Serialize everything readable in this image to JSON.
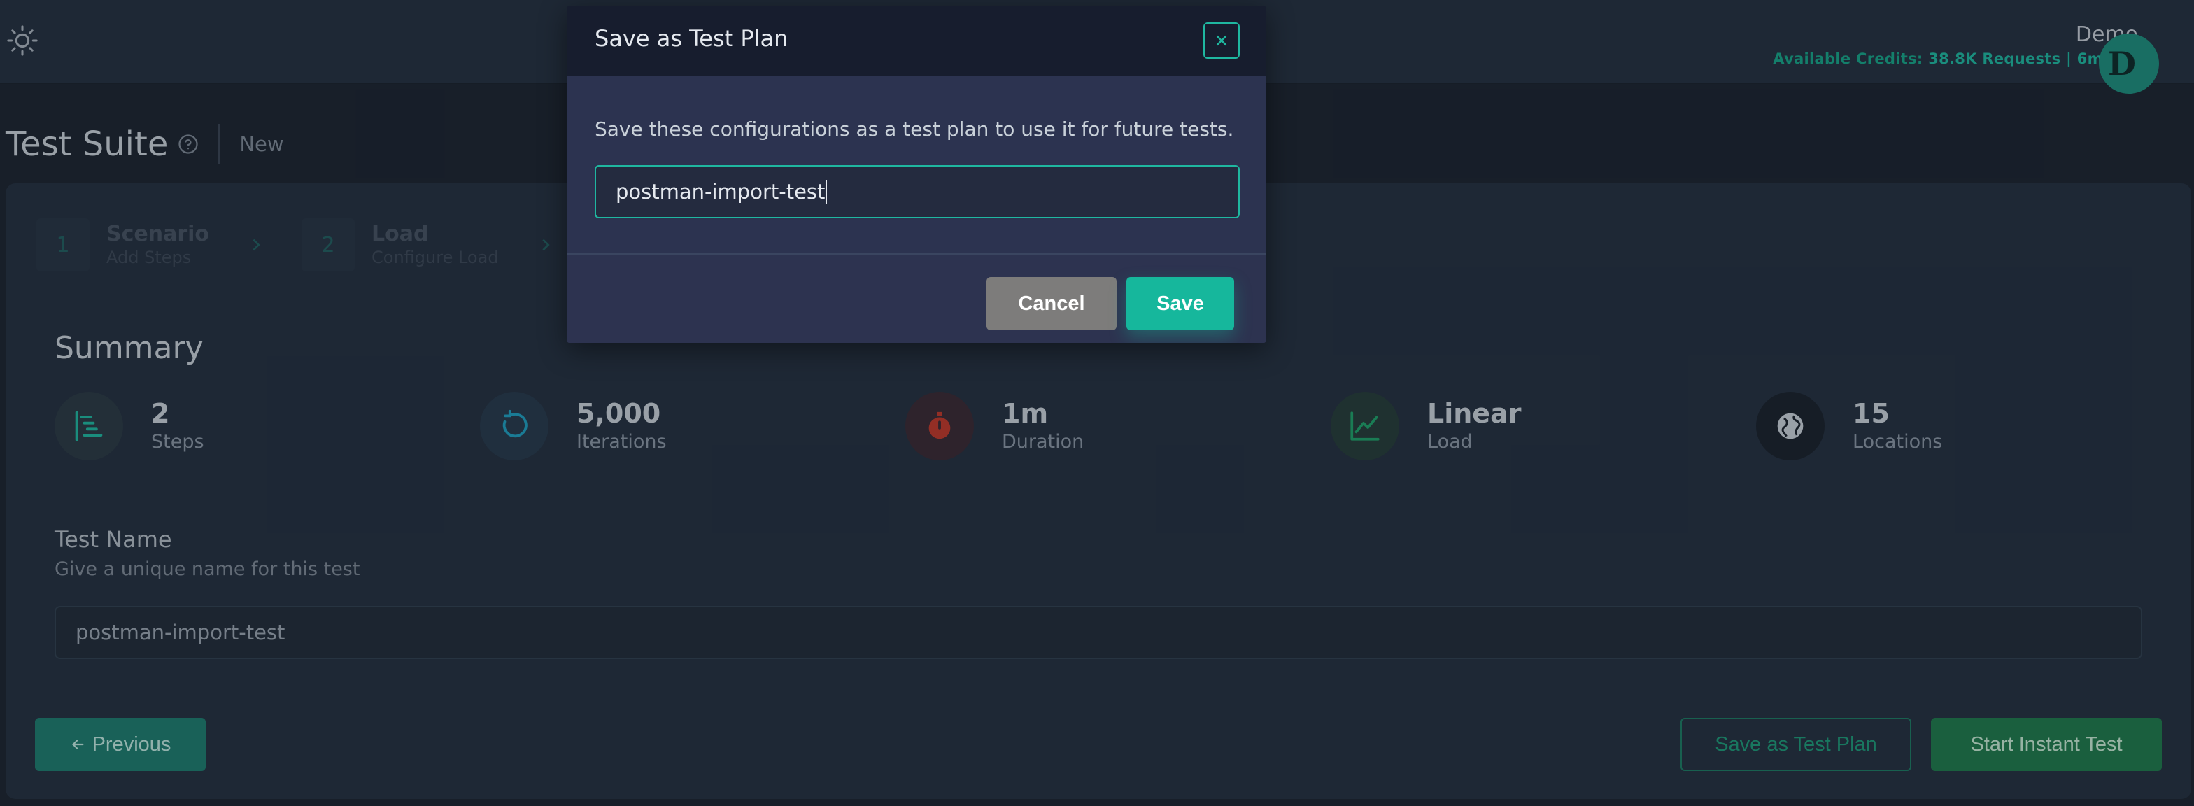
{
  "header": {
    "user_name": "Demo",
    "credits_label": "Available Credits:",
    "credits_value": "38.8K Requests | 6m 20s",
    "avatar_initial": "D"
  },
  "page": {
    "title": "Test Suite",
    "status": "New"
  },
  "steps": [
    {
      "number": "1",
      "title": "Scenario",
      "subtitle": "Add Steps"
    },
    {
      "number": "2",
      "title": "Load",
      "subtitle": "Configure Load"
    }
  ],
  "summary": {
    "title": "Summary",
    "metrics": [
      {
        "value": "2",
        "label": "Steps",
        "icon": "steps-icon",
        "color": "#1fb7a0"
      },
      {
        "value": "5,000",
        "label": "Iterations",
        "icon": "iterations-icon",
        "color": "#1f9fc0"
      },
      {
        "value": "1m",
        "label": "Duration",
        "icon": "stopwatch-icon",
        "color": "#c0392b"
      },
      {
        "value": "Linear",
        "label": "Load",
        "icon": "line-chart-icon",
        "color": "#1fa06a"
      },
      {
        "value": "15",
        "label": "Locations",
        "icon": "globe-icon",
        "color": "#c9d1d9"
      }
    ]
  },
  "test_name": {
    "label": "Test Name",
    "help": "Give a unique name for this test",
    "value": "postman-import-test"
  },
  "actions": {
    "previous": "Previous",
    "save_plan": "Save as Test Plan",
    "start": "Start Instant Test"
  },
  "modal": {
    "title": "Save as Test Plan",
    "description": "Save these configurations as a test plan to use it for future tests.",
    "input_value": "postman-import-test",
    "cancel": "Cancel",
    "save": "Save"
  },
  "colors": {
    "accent": "#1fb7a0",
    "background": "#1c2430",
    "panel": "#243040"
  }
}
